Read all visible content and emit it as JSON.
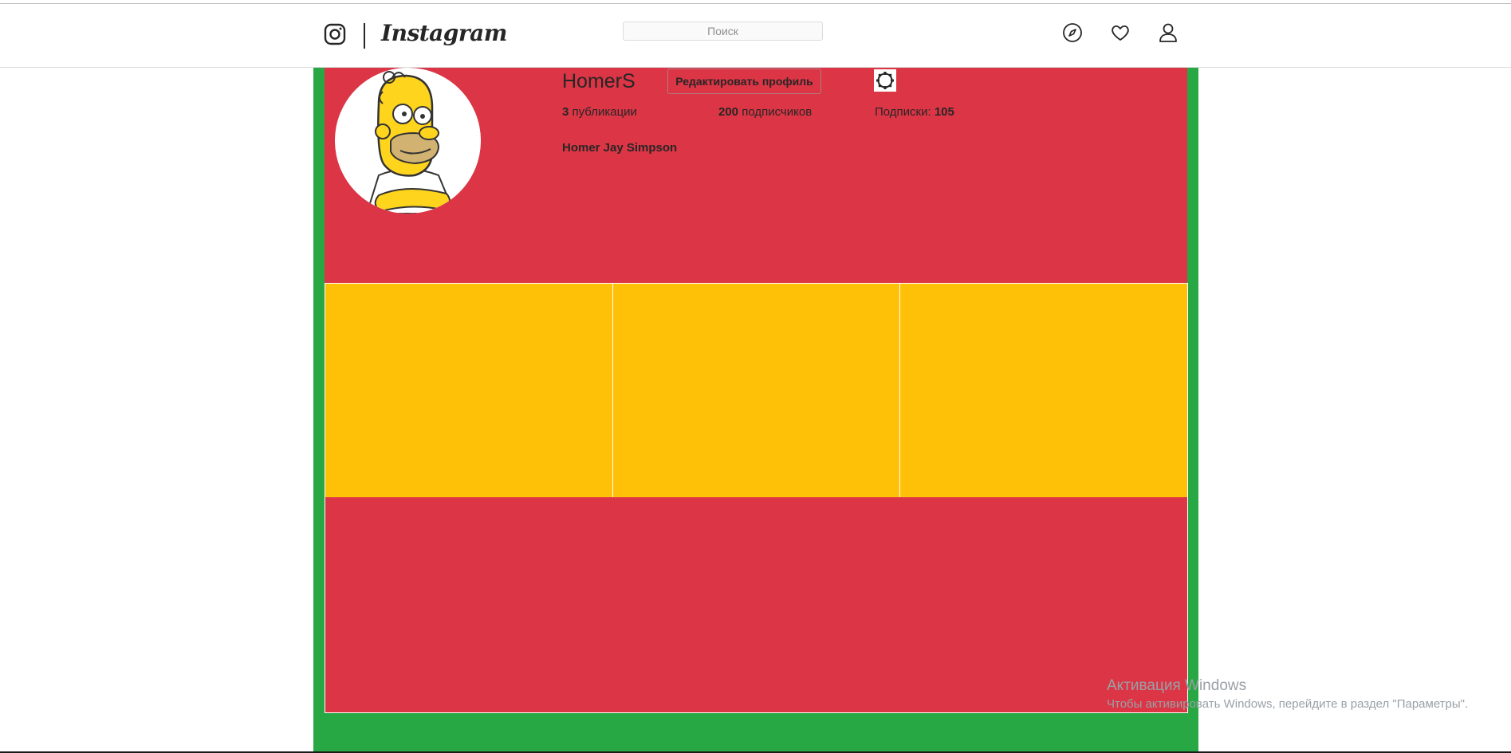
{
  "header": {
    "logo_text": "Instagram",
    "search_placeholder": "Поиск",
    "icons": [
      "instagram-icon",
      "compass-icon",
      "heart-icon",
      "user-icon"
    ]
  },
  "profile": {
    "username": "HomerS",
    "edit_button_label": "Редактировать профиль",
    "settings_icon": "gear-icon",
    "stats": {
      "posts_count": "3",
      "posts_label": "публикации",
      "followers_count": "200",
      "followers_label": "подписчиков",
      "following_label": "Подписки:",
      "following_count": "105"
    },
    "full_name": "Homer Jay Simpson"
  },
  "colors": {
    "frame": "#28a745",
    "panels": "#dc3545",
    "tiles": "#ffc107"
  },
  "watermark": {
    "title": "Активация Windows",
    "subtitle": "Чтобы активировать Windows, перейдите в раздел \"Параметры\"."
  }
}
